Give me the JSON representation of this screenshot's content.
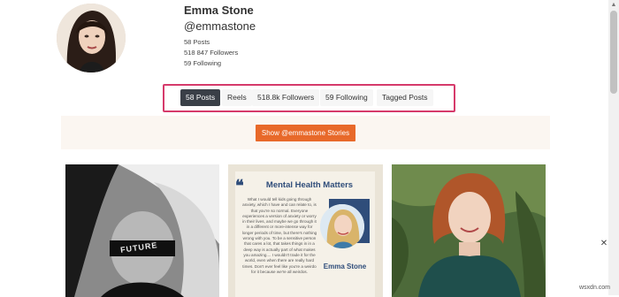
{
  "profile": {
    "name": "Emma Stone",
    "handle": "@emmastone",
    "posts": "58 Posts",
    "followers": "518 847 Followers",
    "following": "59 Following"
  },
  "tabs": [
    {
      "label": "58 Posts",
      "active": true
    },
    {
      "label": "Reels",
      "active": false
    },
    {
      "label": "518.8k Followers",
      "active": false
    },
    {
      "label": "59 Following",
      "active": false
    },
    {
      "label": "Tagged Posts",
      "active": false
    }
  ],
  "stories": {
    "button_label": "Show @emmastone Stories"
  },
  "posts": [
    {
      "type": "photo",
      "caption_text": "FUTURE"
    },
    {
      "type": "quote-card",
      "title": "Mental Health Matters",
      "quote": "What I would tell kids going through anxiety, which I have and can relate to, is that you're so normal. Everyone experiences a version of anxiety or worry in their lives, and maybe we go through it in a different or more-intense way for longer periods of time, but there's nothing wrong with you. To be a sensitive person that cares a lot, that takes things in in a deep way is actually part of what makes you amazing.... I wouldn't trade it for the world, even when there are really hard times. Don't ever feel like you're a weirdo for it because we're all weirdos.",
      "person_name": "Emma Stone"
    },
    {
      "type": "photo"
    }
  ],
  "watermark": "wsxdn.com",
  "colors": {
    "accent": "#e8692a",
    "highlight": "#d63a6b",
    "active_tab": "#3a3f47",
    "card_title": "#2f4d7a"
  }
}
